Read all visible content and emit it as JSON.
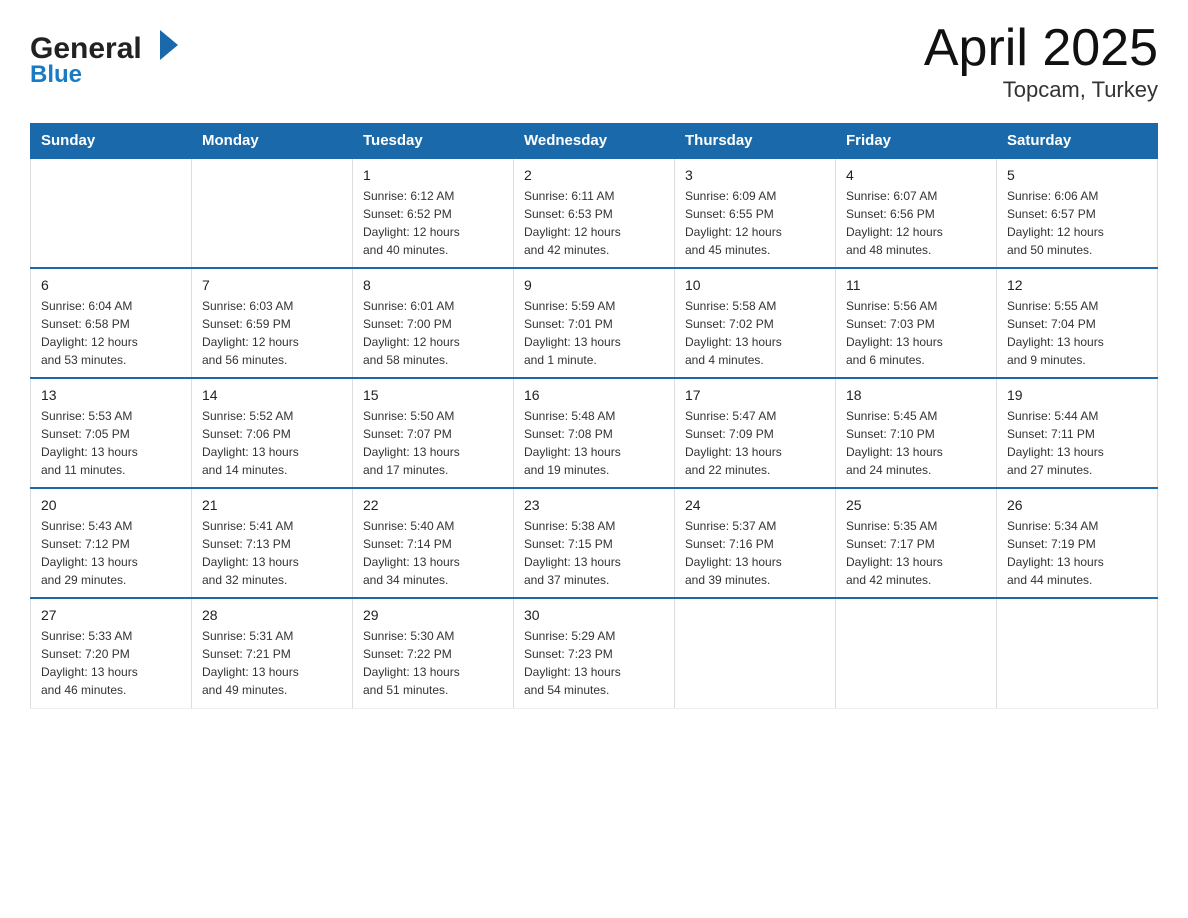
{
  "header": {
    "logo_general": "General",
    "logo_blue": "Blue",
    "title": "April 2025",
    "subtitle": "Topcam, Turkey"
  },
  "columns": [
    "Sunday",
    "Monday",
    "Tuesday",
    "Wednesday",
    "Thursday",
    "Friday",
    "Saturday"
  ],
  "weeks": [
    [
      {
        "day": "",
        "info": ""
      },
      {
        "day": "",
        "info": ""
      },
      {
        "day": "1",
        "info": "Sunrise: 6:12 AM\nSunset: 6:52 PM\nDaylight: 12 hours\nand 40 minutes."
      },
      {
        "day": "2",
        "info": "Sunrise: 6:11 AM\nSunset: 6:53 PM\nDaylight: 12 hours\nand 42 minutes."
      },
      {
        "day": "3",
        "info": "Sunrise: 6:09 AM\nSunset: 6:55 PM\nDaylight: 12 hours\nand 45 minutes."
      },
      {
        "day": "4",
        "info": "Sunrise: 6:07 AM\nSunset: 6:56 PM\nDaylight: 12 hours\nand 48 minutes."
      },
      {
        "day": "5",
        "info": "Sunrise: 6:06 AM\nSunset: 6:57 PM\nDaylight: 12 hours\nand 50 minutes."
      }
    ],
    [
      {
        "day": "6",
        "info": "Sunrise: 6:04 AM\nSunset: 6:58 PM\nDaylight: 12 hours\nand 53 minutes."
      },
      {
        "day": "7",
        "info": "Sunrise: 6:03 AM\nSunset: 6:59 PM\nDaylight: 12 hours\nand 56 minutes."
      },
      {
        "day": "8",
        "info": "Sunrise: 6:01 AM\nSunset: 7:00 PM\nDaylight: 12 hours\nand 58 minutes."
      },
      {
        "day": "9",
        "info": "Sunrise: 5:59 AM\nSunset: 7:01 PM\nDaylight: 13 hours\nand 1 minute."
      },
      {
        "day": "10",
        "info": "Sunrise: 5:58 AM\nSunset: 7:02 PM\nDaylight: 13 hours\nand 4 minutes."
      },
      {
        "day": "11",
        "info": "Sunrise: 5:56 AM\nSunset: 7:03 PM\nDaylight: 13 hours\nand 6 minutes."
      },
      {
        "day": "12",
        "info": "Sunrise: 5:55 AM\nSunset: 7:04 PM\nDaylight: 13 hours\nand 9 minutes."
      }
    ],
    [
      {
        "day": "13",
        "info": "Sunrise: 5:53 AM\nSunset: 7:05 PM\nDaylight: 13 hours\nand 11 minutes."
      },
      {
        "day": "14",
        "info": "Sunrise: 5:52 AM\nSunset: 7:06 PM\nDaylight: 13 hours\nand 14 minutes."
      },
      {
        "day": "15",
        "info": "Sunrise: 5:50 AM\nSunset: 7:07 PM\nDaylight: 13 hours\nand 17 minutes."
      },
      {
        "day": "16",
        "info": "Sunrise: 5:48 AM\nSunset: 7:08 PM\nDaylight: 13 hours\nand 19 minutes."
      },
      {
        "day": "17",
        "info": "Sunrise: 5:47 AM\nSunset: 7:09 PM\nDaylight: 13 hours\nand 22 minutes."
      },
      {
        "day": "18",
        "info": "Sunrise: 5:45 AM\nSunset: 7:10 PM\nDaylight: 13 hours\nand 24 minutes."
      },
      {
        "day": "19",
        "info": "Sunrise: 5:44 AM\nSunset: 7:11 PM\nDaylight: 13 hours\nand 27 minutes."
      }
    ],
    [
      {
        "day": "20",
        "info": "Sunrise: 5:43 AM\nSunset: 7:12 PM\nDaylight: 13 hours\nand 29 minutes."
      },
      {
        "day": "21",
        "info": "Sunrise: 5:41 AM\nSunset: 7:13 PM\nDaylight: 13 hours\nand 32 minutes."
      },
      {
        "day": "22",
        "info": "Sunrise: 5:40 AM\nSunset: 7:14 PM\nDaylight: 13 hours\nand 34 minutes."
      },
      {
        "day": "23",
        "info": "Sunrise: 5:38 AM\nSunset: 7:15 PM\nDaylight: 13 hours\nand 37 minutes."
      },
      {
        "day": "24",
        "info": "Sunrise: 5:37 AM\nSunset: 7:16 PM\nDaylight: 13 hours\nand 39 minutes."
      },
      {
        "day": "25",
        "info": "Sunrise: 5:35 AM\nSunset: 7:17 PM\nDaylight: 13 hours\nand 42 minutes."
      },
      {
        "day": "26",
        "info": "Sunrise: 5:34 AM\nSunset: 7:19 PM\nDaylight: 13 hours\nand 44 minutes."
      }
    ],
    [
      {
        "day": "27",
        "info": "Sunrise: 5:33 AM\nSunset: 7:20 PM\nDaylight: 13 hours\nand 46 minutes."
      },
      {
        "day": "28",
        "info": "Sunrise: 5:31 AM\nSunset: 7:21 PM\nDaylight: 13 hours\nand 49 minutes."
      },
      {
        "day": "29",
        "info": "Sunrise: 5:30 AM\nSunset: 7:22 PM\nDaylight: 13 hours\nand 51 minutes."
      },
      {
        "day": "30",
        "info": "Sunrise: 5:29 AM\nSunset: 7:23 PM\nDaylight: 13 hours\nand 54 minutes."
      },
      {
        "day": "",
        "info": ""
      },
      {
        "day": "",
        "info": ""
      },
      {
        "day": "",
        "info": ""
      }
    ]
  ]
}
